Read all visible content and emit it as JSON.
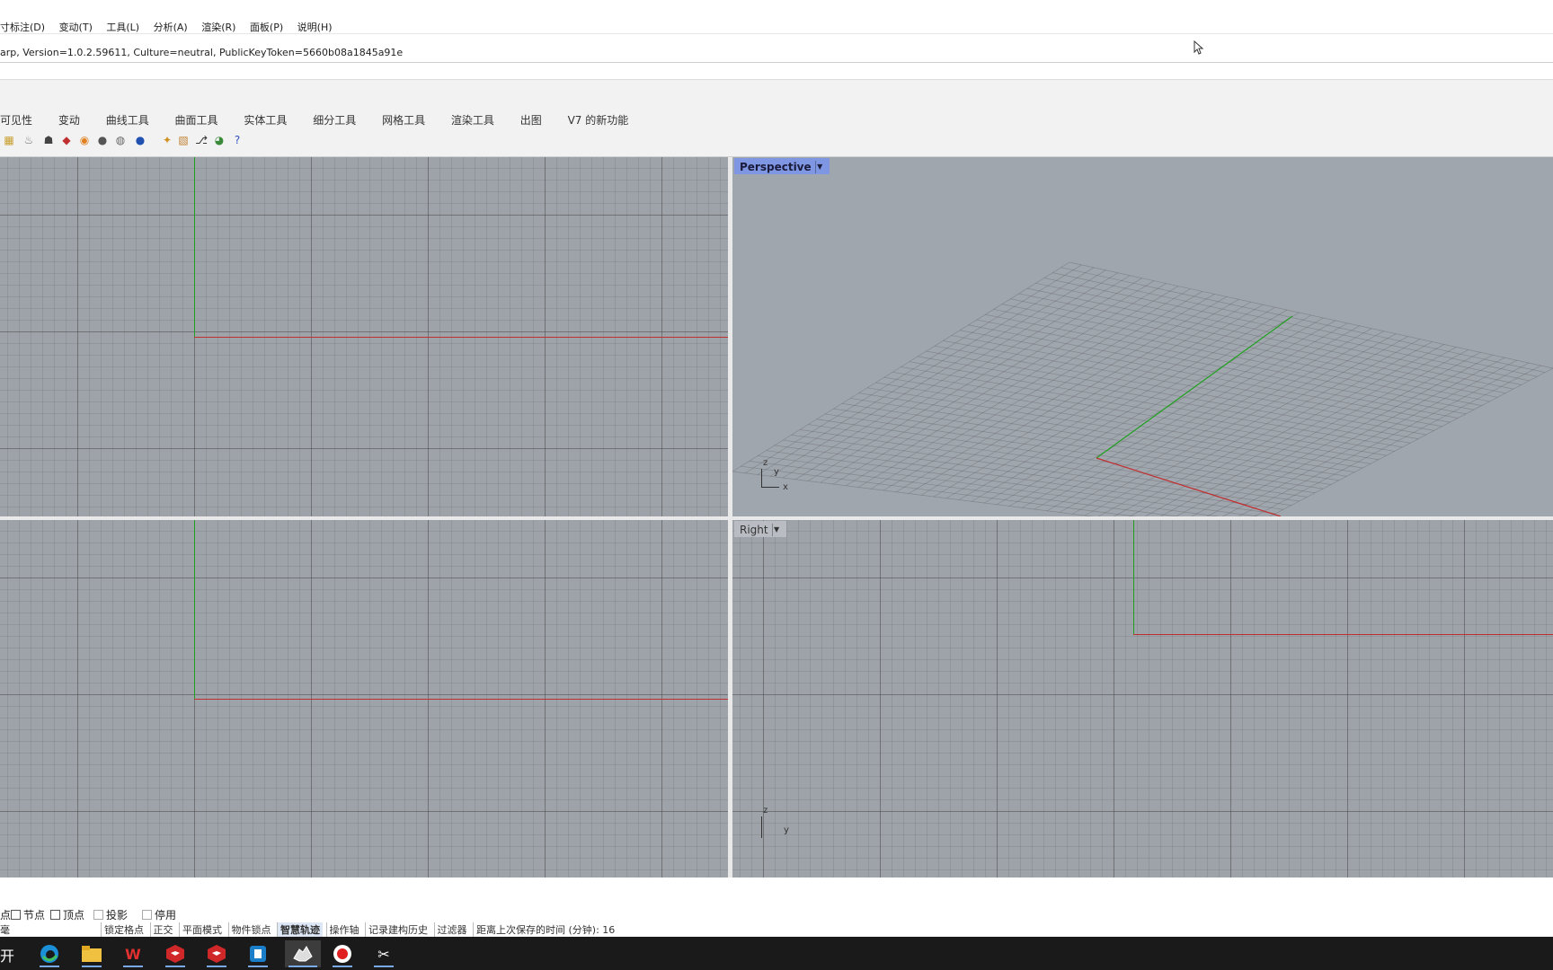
{
  "menu": {
    "items": [
      "寸标注(D)",
      "变动(T)",
      "工具(L)",
      "分析(A)",
      "渲染(R)",
      "面板(P)",
      "说明(H)"
    ]
  },
  "command": {
    "history": "arp, Version=1.0.2.59611, Culture=neutral, PublicKeyToken=5660b08a1845a91e"
  },
  "tabs": [
    "可见性",
    "变动",
    "曲线工具",
    "曲面工具",
    "实体工具",
    "细分工具",
    "网格工具",
    "渲染工具",
    "出图",
    "V7 的新功能"
  ],
  "toolbar_icons": [
    "layout-icon",
    "lightbulb-icon",
    "layer-icon",
    "material-icon",
    "color-wheel-icon",
    "sphere-icon",
    "render-sphere-icon",
    "environment-icon",
    "light-icon",
    "texture-icon",
    "camera-icon",
    "globe-icon",
    "help-icon"
  ],
  "viewports": {
    "perspective": {
      "label": "Perspective",
      "gizmo_z": "z",
      "gizmo_y": "y",
      "gizmo_x": "x"
    },
    "right": {
      "label": "Right",
      "gizmo_z": "z",
      "gizmo_y": "y"
    }
  },
  "snaps": [
    {
      "label": "点",
      "checked": false
    },
    {
      "label": "节点",
      "checked": false
    },
    {
      "label": "顶点",
      "checked": false
    },
    {
      "label": "投影",
      "checked": false
    },
    {
      "label": "停用",
      "checked": false
    }
  ],
  "status": {
    "left": "毫",
    "items": [
      "锁定格点",
      "正交",
      "平面模式",
      "物件锁点",
      "智慧轨迹",
      "操作轴",
      "记录建构历史",
      "过滤器",
      "距离上次保存的时间 (分钟): 16"
    ],
    "active_item": "智慧轨迹"
  },
  "taskbar": {
    "start_label": "开始",
    "apps": [
      "edge-icon",
      "file-explorer-icon",
      "wps-icon",
      "sketchup-icon",
      "sketchup-2-icon",
      "sketchup-3d-icon",
      "rhino-icon",
      "recorder-icon",
      "capcut-icon"
    ]
  },
  "colors": {
    "viewport_bg": "#9ea3aa",
    "axis_x": "#c03030",
    "axis_y": "#20a020",
    "active_label": "#7f97e3"
  }
}
